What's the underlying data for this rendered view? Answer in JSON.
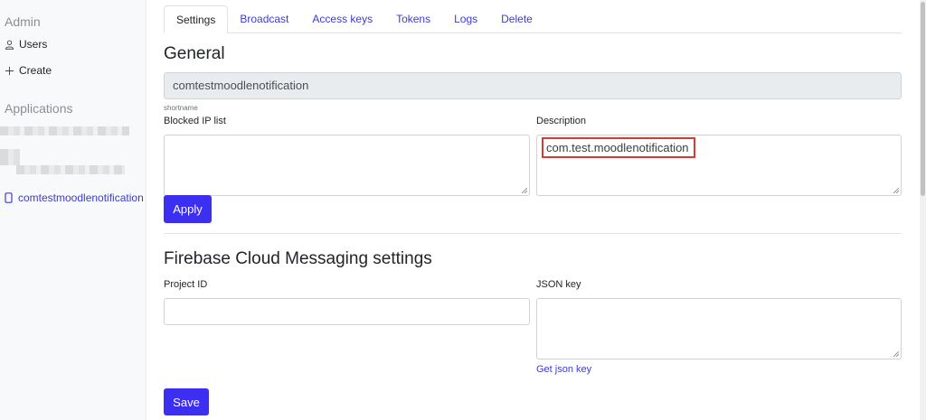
{
  "sidebar": {
    "admin_heading": "Admin",
    "users_label": "Users",
    "create_label": "Create",
    "applications_heading": "Applications",
    "active_app_label": "comtestmoodlenotification"
  },
  "tabs": [
    "Settings",
    "Broadcast",
    "Access keys",
    "Tokens",
    "Logs",
    "Delete"
  ],
  "general": {
    "title": "General",
    "shortname_value": "comtestmoodlenotification",
    "shortname_hint": "shortname",
    "blocked_ip_label": "Blocked IP list",
    "description_label": "Description",
    "description_value": "com.test.moodlenotification",
    "apply_button": "Apply"
  },
  "firebase": {
    "title": "Firebase Cloud Messaging settings",
    "project_id_label": "Project ID",
    "json_key_label": "JSON key",
    "get_json_key_link": "Get json key",
    "save_button": "Save"
  },
  "colors": {
    "accent": "#3d2ff2",
    "link": "#3b3bd8",
    "highlight_border": "#d33a3a"
  }
}
